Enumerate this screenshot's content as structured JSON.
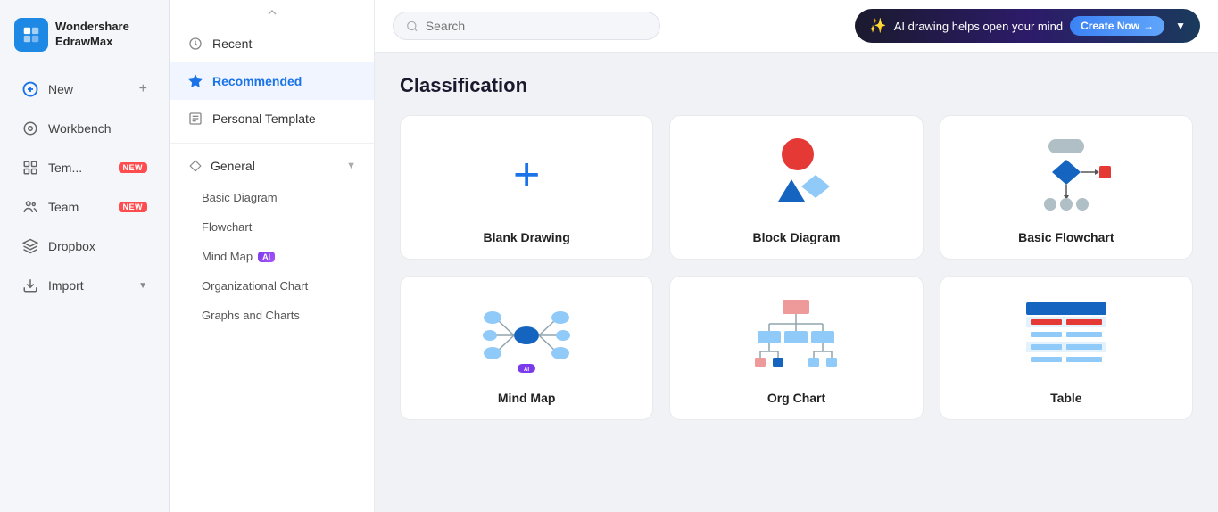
{
  "app": {
    "logo_line1": "Wondershare",
    "logo_line2": "EdrawMax"
  },
  "sidebar": {
    "items": [
      {
        "id": "new",
        "label": "New",
        "icon": "plus-circle-icon",
        "badge": null
      },
      {
        "id": "workbench",
        "label": "Workbench",
        "icon": "grid-icon",
        "badge": null
      },
      {
        "id": "templates",
        "label": "Tem...",
        "icon": "template-icon",
        "badge": "NEW"
      },
      {
        "id": "team",
        "label": "Team",
        "icon": "team-icon",
        "badge": "NEW"
      },
      {
        "id": "dropbox",
        "label": "Dropbox",
        "icon": "dropbox-icon",
        "badge": null
      },
      {
        "id": "import",
        "label": "Import",
        "icon": "import-icon",
        "badge": null
      }
    ]
  },
  "menu": {
    "items": [
      {
        "id": "recent",
        "label": "Recent",
        "icon": "clock-icon",
        "active": false
      },
      {
        "id": "recommended",
        "label": "Recommended",
        "icon": "star-icon",
        "active": true
      },
      {
        "id": "personal-template",
        "label": "Personal Template",
        "icon": "file-icon",
        "active": false
      }
    ],
    "sections": [
      {
        "id": "general",
        "label": "General",
        "icon": "diamond-icon",
        "expanded": true,
        "sub_items": [
          {
            "id": "basic-diagram",
            "label": "Basic Diagram"
          },
          {
            "id": "flowchart",
            "label": "Flowchart"
          },
          {
            "id": "mind-map",
            "label": "Mind Map",
            "ai": true
          },
          {
            "id": "org-chart",
            "label": "Organizational Chart"
          },
          {
            "id": "graphs-charts",
            "label": "Graphs and Charts"
          }
        ]
      }
    ]
  },
  "topbar": {
    "search_placeholder": "Search",
    "ai_banner_text": "AI drawing helps open your mind",
    "ai_banner_btn": "Create Now",
    "ai_banner_arrow": "→"
  },
  "main": {
    "section_title": "Classification",
    "cards": [
      {
        "id": "blank-drawing",
        "label": "Blank Drawing",
        "type": "blank"
      },
      {
        "id": "block-diagram",
        "label": "Block Diagram",
        "type": "block"
      },
      {
        "id": "basic-flowchart",
        "label": "Basic Flowchart",
        "type": "flowchart"
      },
      {
        "id": "mind-map-card",
        "label": "Mind Map",
        "type": "mindmap"
      },
      {
        "id": "org-chart-card",
        "label": "Org Chart",
        "type": "orgchart"
      },
      {
        "id": "table-card",
        "label": "Table",
        "type": "table"
      }
    ]
  }
}
